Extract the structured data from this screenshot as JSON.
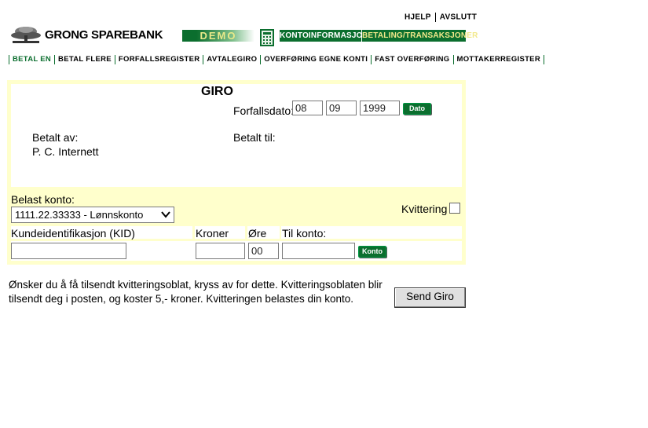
{
  "header": {
    "links": [
      "HJELP",
      "AVSLUTT"
    ],
    "logo_text": "GRONG SPAREBANK",
    "demo_label": "DEMO",
    "tabs": [
      "KONTOINFORMASJON",
      "BETALING/TRANSAKSJONER"
    ]
  },
  "subnav": [
    "BETAL EN",
    "BETAL FLERE",
    "FORFALLSREGISTER",
    "AVTALEGIRO",
    "OVERFØRING EGNE KONTI",
    "FAST OVERFØRING",
    "MOTTAKERREGISTER"
  ],
  "giro": {
    "title": "GIRO",
    "due_label": "Forfallsdato:",
    "due_day": "08",
    "due_month": "09",
    "due_year": "1999",
    "date_button": "Dato",
    "paid_by_label": "Betalt av:",
    "paid_by_value": "P. C. Internett",
    "paid_to_label": "Betalt til:",
    "debit_label": "Belast konto:",
    "debit_selected": "1111.22.33333 - Lønnskonto",
    "receipt_label": "Kvittering",
    "kid_label": "Kundeidentifikasjon (KID)",
    "kid_value": "",
    "kroner_label": "Kroner",
    "kroner_value": "",
    "ore_label": "Øre",
    "ore_value": "00",
    "to_account_label": "Til konto:",
    "to_account_value": "",
    "account_button": "Konto"
  },
  "footer": {
    "text": "Ønsker du å få tilsendt kvitteringsoblat, kryss av for dette. Kvitteringsoblaten blir tilsendt deg i posten, og koster 5,- kroner. Kvitteringen belastes din konto.",
    "send_button": "Send Giro"
  }
}
